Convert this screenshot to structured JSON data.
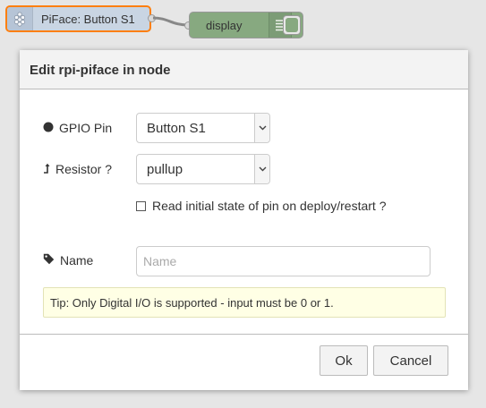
{
  "flow": {
    "source_node": {
      "label": "PiFace: Button S1",
      "icon": "raspberry-pi-icon",
      "selected_border_color": "#ff7f0e",
      "color": "#c9d5e3"
    },
    "display_node": {
      "label": "display",
      "icon": "list-icon",
      "color": "#87a980"
    }
  },
  "dialog": {
    "title": "Edit rpi-piface in node",
    "gpio_pin": {
      "label": "GPIO Pin",
      "icon": "circle-icon",
      "value": "Button S1"
    },
    "resistor": {
      "label": "Resistor ?",
      "icon": "level-up-icon",
      "value": "pullup"
    },
    "read_initial": {
      "label": "Read initial state of pin on deploy/restart ?",
      "checked": false
    },
    "name": {
      "label": "Name",
      "icon": "tag-icon",
      "value": "",
      "placeholder": "Name"
    },
    "tip": "Tip: Only Digital I/O is supported - input must be 0 or 1.",
    "buttons": {
      "ok": "Ok",
      "cancel": "Cancel"
    }
  }
}
